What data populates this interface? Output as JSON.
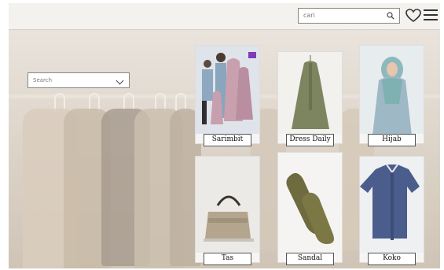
{
  "header": {
    "search_placeholder": "cari",
    "icons": [
      "search-icon",
      "heart-icon",
      "menu-icon"
    ]
  },
  "filter": {
    "placeholder": "Search"
  },
  "categories": [
    {
      "label": "Sarimbit"
    },
    {
      "label": "Dress Daily"
    },
    {
      "label": "Hijab"
    },
    {
      "label": "Tas"
    },
    {
      "label": "Sandal"
    },
    {
      "label": "Koko"
    }
  ]
}
